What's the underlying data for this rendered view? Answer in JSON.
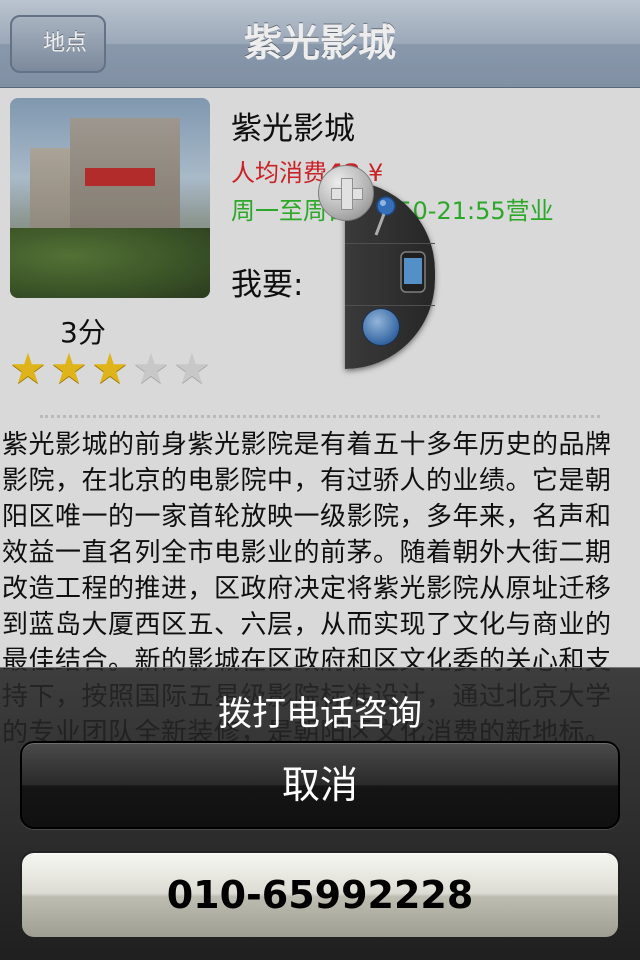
{
  "nav": {
    "back_label": "地点",
    "title": "紫光影城"
  },
  "venue": {
    "name": "紫光影城",
    "price_prefix": "人均消费",
    "price_value": "42",
    "price_suffix": " ¥",
    "hours": "周一至周日  09:50-21:55营业",
    "want_label": "我要:",
    "score_text": "3分",
    "rating": 3,
    "rating_max": 5
  },
  "description": "紫光影城的前身紫光影院是有着五十多年历史的品牌影院，在北京的电影院中，有过骄人的业绩。它是朝阳区唯一的一家首轮放映一级影院，多年来，名声和效益一直名列全市电影业的前茅。随着朝外大街二期改造工程的推进，区政府决定将紫光影院从原址迁移到蓝岛大厦西区五、六层，从而实现了文化与商业的最佳结合。新的影城在区政府和区文化委的关心和支持下，按照国际五星级影院标准设计，通过北京大学的专业团队全新装修，是朝阳区文化消费的新地标。",
  "radial_menu": {
    "items": [
      "pin-icon",
      "phone-icon",
      "globe-icon"
    ]
  },
  "action_sheet": {
    "title": "拨打电话咨询",
    "cancel_label": "取消",
    "phone_label": "010-65992228"
  },
  "colors": {
    "price": "#d9252a",
    "hours": "#2fb52c",
    "star_on": "#f0c21e"
  }
}
